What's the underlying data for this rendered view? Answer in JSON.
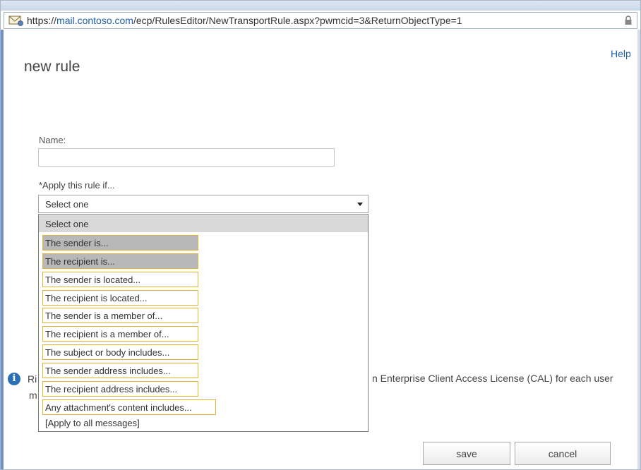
{
  "browser": {
    "url_scheme": "https://",
    "url_domain": "mail.contoso.com",
    "url_path": "/ecp/RulesEditor/NewTransportRule.aspx?pwmcid=3&ReturnObjectType=1"
  },
  "dialog": {
    "help": "Help",
    "title": "new rule"
  },
  "form": {
    "name_label": "Name:",
    "name_value": "",
    "apply_label": "*Apply this rule if...",
    "select_value": "Select one"
  },
  "dropdown": {
    "header_option": "Select one",
    "options": [
      {
        "label": "The sender is..."
      },
      {
        "label": "The recipient is..."
      },
      {
        "label": "The sender is located..."
      },
      {
        "label": "The recipient is located..."
      },
      {
        "label": "The sender is a member of..."
      },
      {
        "label": "The recipient is a member of..."
      },
      {
        "label": "The subject or body includes..."
      },
      {
        "label": "The sender address includes..."
      },
      {
        "label": "The recipient address includes..."
      },
      {
        "label": "Any attachment's content includes..."
      }
    ],
    "last_option": "[Apply to all messages]"
  },
  "info": {
    "text_left": "Ri",
    "text_right": "n Enterprise Client Access License (CAL) for each user",
    "text_left_line2": "m"
  },
  "buttons": {
    "save": "save",
    "cancel": "cancel"
  },
  "colors": {
    "link": "#1f5fa8",
    "option_border": "#e2b431",
    "info_icon": "#2a6fb8"
  }
}
